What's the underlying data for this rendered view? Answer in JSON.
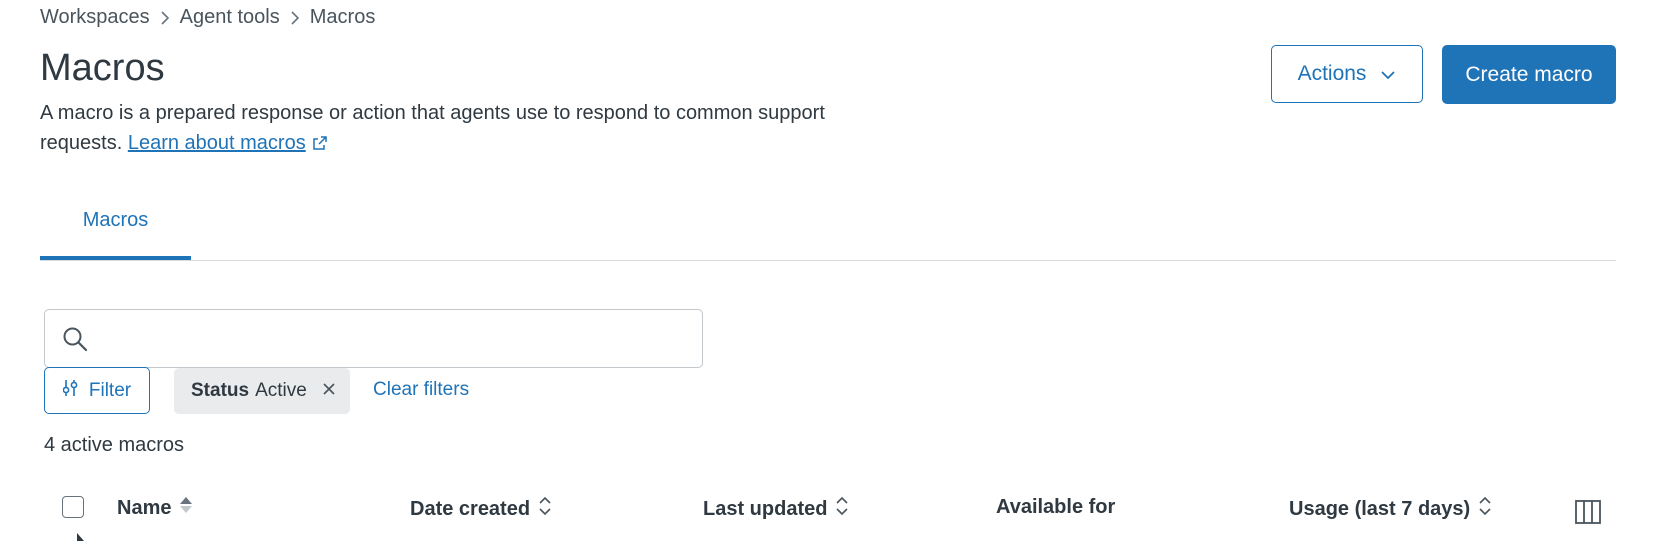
{
  "breadcrumb": {
    "items": [
      "Workspaces",
      "Agent tools",
      "Macros"
    ]
  },
  "header": {
    "title": "Macros",
    "description": "A macro is a prepared response or action that agents use to respond to common support requests.",
    "learn_link": "Learn about macros",
    "actions_label": "Actions",
    "create_label": "Create macro"
  },
  "tabs": [
    {
      "label": "Macros",
      "active": true
    }
  ],
  "search": {
    "value": "",
    "placeholder": ""
  },
  "filters": {
    "filter_label": "Filter",
    "chip_key": "Status",
    "chip_value": "Active",
    "clear_label": "Clear filters"
  },
  "summary": {
    "count_text": "4 active macros"
  },
  "table": {
    "columns": [
      "Name",
      "Date created",
      "Last updated",
      "Available for",
      "Usage (last 7 days)"
    ]
  },
  "icons": {
    "breadcrumb_separator": "chevron-right-icon",
    "external_link": "external-link-icon",
    "actions_dropdown": "chevron-down-icon",
    "search": "search-icon",
    "filter": "sliders-icon",
    "chip_remove": "close-icon",
    "sort": "sort-icon",
    "columns": "columns-icon"
  },
  "colors": {
    "accent": "#1f73b7",
    "text": "#2f3941",
    "chip_bg": "#e9ebed",
    "border": "#d8dcde"
  }
}
